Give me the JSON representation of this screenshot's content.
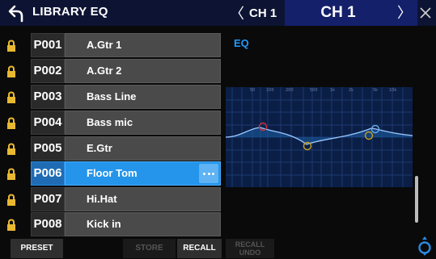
{
  "header": {
    "title": "LIBRARY EQ",
    "ch_prev_label": "CH 1",
    "ch_main_label": "CH 1",
    "background": "#0d1433",
    "accent": "#14206a"
  },
  "library": {
    "items": [
      {
        "code": "P001",
        "name": "A.Gtr 1",
        "locked": true
      },
      {
        "code": "P002",
        "name": "A.Gtr 2",
        "locked": true
      },
      {
        "code": "P003",
        "name": "Bass Line",
        "locked": true
      },
      {
        "code": "P004",
        "name": "Bass mic",
        "locked": true
      },
      {
        "code": "P005",
        "name": "E.Gtr",
        "locked": true
      },
      {
        "code": "P006",
        "name": "Floor Tom",
        "locked": true,
        "selected": true
      },
      {
        "code": "P007",
        "name": "Hi.Hat",
        "locked": true
      },
      {
        "code": "P008",
        "name": "Kick in",
        "locked": true
      }
    ],
    "lock_color": "#e8b830",
    "selected_color": "#2495ea"
  },
  "eq": {
    "label": "EQ",
    "freq_ticks": [
      "50",
      "100",
      "200",
      "500",
      "1k",
      "2k",
      "5k",
      "10k"
    ],
    "band_colors": [
      "#d0303a",
      "#c8a020",
      "#c8a020",
      "#6aa8e8"
    ]
  },
  "toolbar": {
    "preset": "PRESET",
    "store": "STORE",
    "recall": "RECALL",
    "recall_undo_line1": "RECALL",
    "recall_undo_line2": "UNDO"
  }
}
